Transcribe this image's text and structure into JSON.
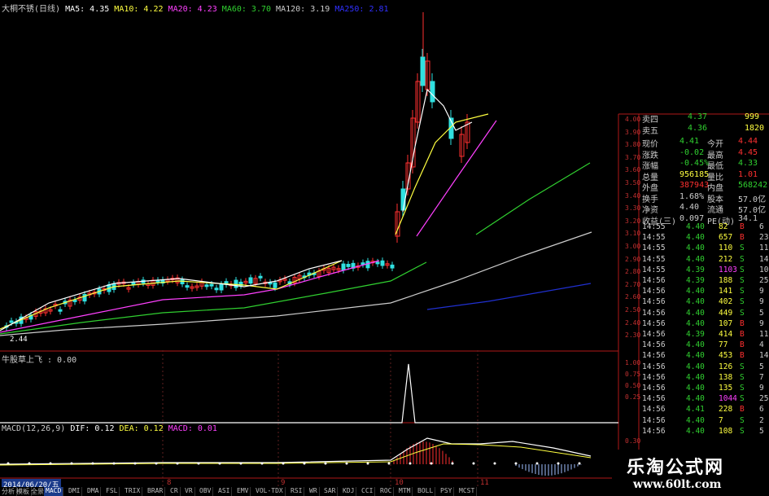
{
  "colors": {
    "bg": "#000000",
    "red": "#ff3030",
    "green": "#30d030",
    "white": "#ffffff",
    "yellow": "#ffff40",
    "magenta": "#ff40ff",
    "axis": "#a02020"
  },
  "legend": [
    {
      "text": "大桐不锈(日线)",
      "color": "#cccccc"
    },
    {
      "text": "MA5: 4.35",
      "color": "#ffffff"
    },
    {
      "text": "MA10: 4.22",
      "color": "#ffff40"
    },
    {
      "text": "MA20: 4.23",
      "color": "#ff40ff"
    },
    {
      "text": "MA60: 3.70",
      "color": "#30d030"
    },
    {
      "text": "MA120: 3.19",
      "color": "#cccccc"
    },
    {
      "text": "MA250: 2.81",
      "color": "#3030ff"
    }
  ],
  "price_scale": [
    "4.00",
    "3.90",
    "3.80",
    "3.70",
    "3.60",
    "3.50",
    "3.40",
    "3.30",
    "3.20",
    "3.10",
    "3.00",
    "2.90",
    "2.80",
    "2.70",
    "2.60",
    "2.50",
    "2.40",
    "2.30"
  ],
  "low_marker": "2.44",
  "indicator": {
    "title": "牛股草上飞 : 0.00",
    "scale": [
      "1.00",
      "0.75",
      "0.50",
      "0.25"
    ]
  },
  "macd": {
    "title": "MACD(12,26,9)",
    "dif": "DIF: 0.12",
    "dea": "DEA: 0.12",
    "macd": "MACD: 0.01",
    "scale": "0.30"
  },
  "x_labels": [
    "8",
    "9",
    "10",
    "11"
  ],
  "date": "2014/06/20/五",
  "quote": [
    {
      "label": "卖四",
      "value": "4.37",
      "vol": "999"
    },
    {
      "label": "卖五",
      "value": "4.36",
      "vol": "1820"
    }
  ],
  "stats": [
    {
      "l1": "现价",
      "v1": "4.41",
      "l2": "今开",
      "v2": "4.44"
    },
    {
      "l1": "涨跌",
      "v1": "-0.02",
      "l2": "最高",
      "v2": "4.45"
    },
    {
      "l1": "涨幅",
      "v1": "-0.45%",
      "l2": "最低",
      "v2": "4.33"
    },
    {
      "l1": "总量",
      "v1": "956185",
      "l2": "量比",
      "v2": "1.01"
    },
    {
      "l1": "外盘",
      "v1": "387943",
      "l2": "内盘",
      "v2": "568242"
    },
    {
      "l1": "换手",
      "v1": "1.68%",
      "l2": "股本",
      "v2": "57.0亿"
    },
    {
      "l1": "净资",
      "v1": "4.40",
      "l2": "流通",
      "v2": "57.0亿"
    },
    {
      "l1": "收益(三)",
      "v1": "0.097",
      "l2": "PE(动)",
      "v2": "34.1"
    }
  ],
  "ticks": [
    {
      "t": "14:55",
      "p": "4.40",
      "v": "82",
      "d": "B",
      "n": "6"
    },
    {
      "t": "14:55",
      "p": "4.40",
      "v": "657",
      "d": "B",
      "n": "23"
    },
    {
      "t": "14:55",
      "p": "4.40",
      "v": "110",
      "d": "S",
      "n": "11"
    },
    {
      "t": "14:55",
      "p": "4.40",
      "v": "212",
      "d": "S",
      "n": "14"
    },
    {
      "t": "14:55",
      "p": "4.39",
      "v": "1103",
      "d": "S",
      "n": "10"
    },
    {
      "t": "14:56",
      "p": "4.39",
      "v": "188",
      "d": "S",
      "n": "25"
    },
    {
      "t": "14:56",
      "p": "4.40",
      "v": "141",
      "d": "S",
      "n": "9"
    },
    {
      "t": "14:56",
      "p": "4.40",
      "v": "402",
      "d": "S",
      "n": "9"
    },
    {
      "t": "14:56",
      "p": "4.40",
      "v": "449",
      "d": "S",
      "n": "5"
    },
    {
      "t": "14:56",
      "p": "4.40",
      "v": "107",
      "d": "B",
      "n": "9"
    },
    {
      "t": "14:56",
      "p": "4.39",
      "v": "414",
      "d": "B",
      "n": "11"
    },
    {
      "t": "14:56",
      "p": "4.40",
      "v": "77",
      "d": "B",
      "n": "4"
    },
    {
      "t": "14:56",
      "p": "4.40",
      "v": "453",
      "d": "B",
      "n": "14"
    },
    {
      "t": "14:56",
      "p": "4.40",
      "v": "126",
      "d": "S",
      "n": "5"
    },
    {
      "t": "14:56",
      "p": "4.40",
      "v": "138",
      "d": "S",
      "n": "7"
    },
    {
      "t": "14:56",
      "p": "4.40",
      "v": "135",
      "d": "S",
      "n": "9"
    },
    {
      "t": "14:56",
      "p": "4.40",
      "v": "1044",
      "d": "S",
      "n": "25"
    },
    {
      "t": "14:56",
      "p": "4.41",
      "v": "228",
      "d": "B",
      "n": "6"
    },
    {
      "t": "14:56",
      "p": "4.40",
      "v": "7",
      "d": "S",
      "n": "2"
    },
    {
      "t": "14:56",
      "p": "4.40",
      "v": "108",
      "d": "S",
      "n": "5"
    }
  ],
  "tabs": [
    "分析",
    "模板",
    "全景",
    "MACD",
    "DMI",
    "DMA",
    "FSL",
    "TRIX",
    "BRAR",
    "CR",
    "VR",
    "OBV",
    "ASI",
    "EMV",
    "VOL-TDX",
    "RSI",
    "WR",
    "SAR",
    "KDJ",
    "CCI",
    "ROC",
    "MTM",
    "BOLL",
    "PSY",
    "MCST"
  ],
  "watermark": {
    "title": "乐淘公式网",
    "url": "www.60lt.com"
  }
}
